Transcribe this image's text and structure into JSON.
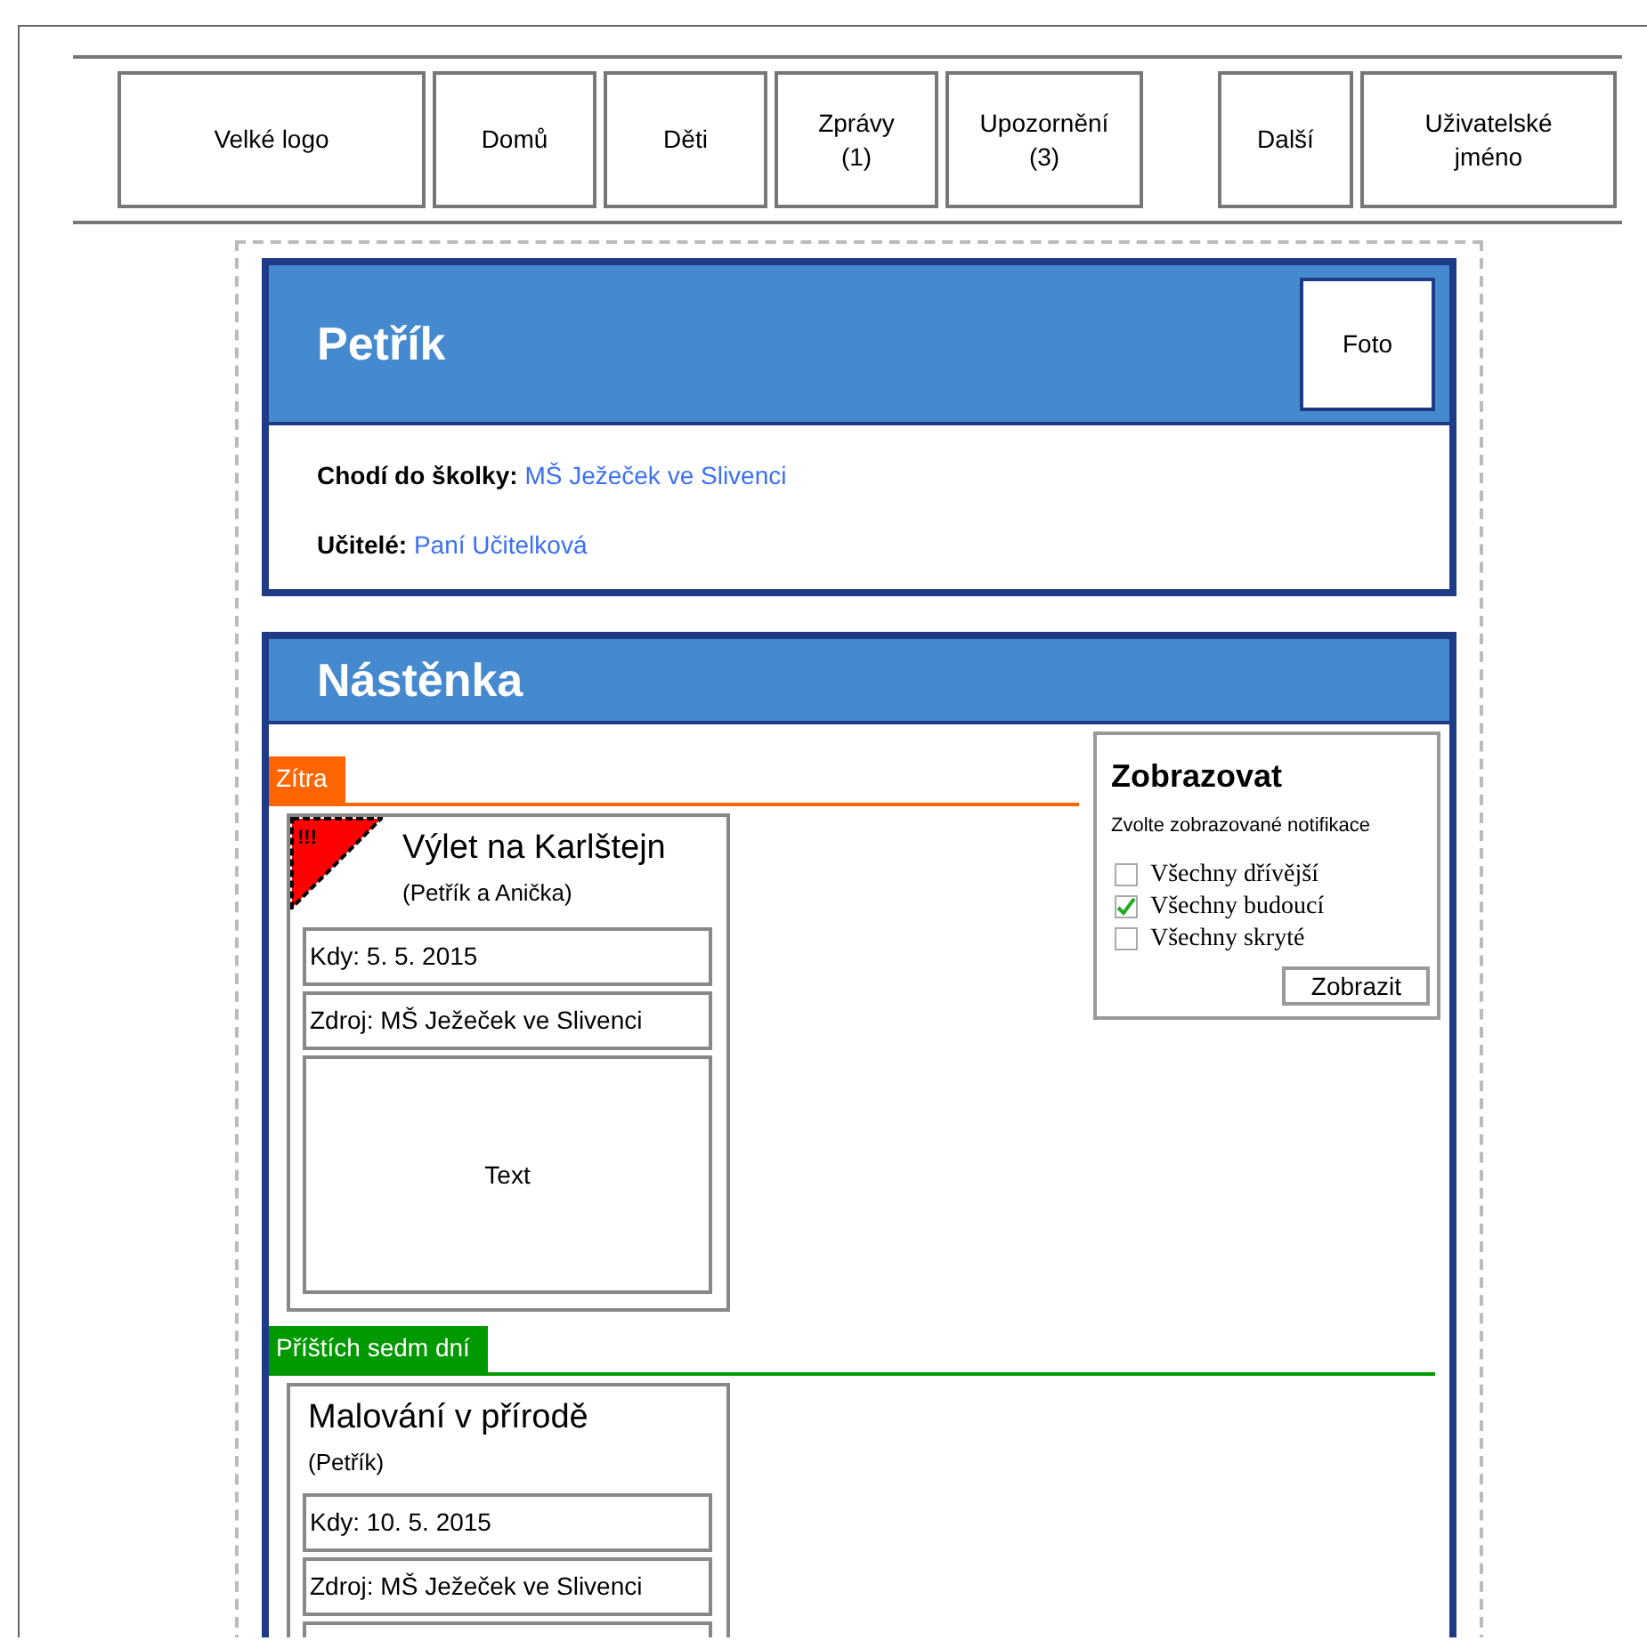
{
  "nav": {
    "logo": "Velké logo",
    "left": [
      {
        "label": "Domů"
      },
      {
        "label": "Děti"
      },
      {
        "label": "Zprávy (1)"
      },
      {
        "label": "Upozornění (3)"
      }
    ],
    "right": [
      {
        "label": "Další"
      },
      {
        "label": "Uživatelské jméno"
      }
    ]
  },
  "profile": {
    "name": "Petřík",
    "photo": "Foto",
    "facts": [
      {
        "label": "Chodí do školky:",
        "value": "MŠ Ježeček ve Slivenci"
      },
      {
        "label": "Učitelé:",
        "value": "Paní Učitelková"
      }
    ]
  },
  "board": {
    "title": "Nástěnka",
    "sections": [
      {
        "label": "Zítra",
        "color": "#ff6600",
        "events": [
          {
            "title": "Výlet na Karlštejn",
            "participants": "(Petřík a Anička)",
            "urgent": "!!!",
            "fields": [
              "Kdy: 5. 5. 2015",
              "Zdroj: MŠ Ježeček ve Slivenci"
            ],
            "body": "Text"
          }
        ]
      },
      {
        "label": "Příštích sedm dní",
        "color": "#009900",
        "events": [
          {
            "title": "Malování v přírodě",
            "participants": "(Petřík)",
            "fields": [
              "Kdy: 10. 5. 2015",
              "Zdroj: MŠ Ježeček ve Slivenci"
            ]
          }
        ]
      }
    ],
    "filter": {
      "title": "Zobrazovat",
      "hint": "Zvolte zobrazované notifikace",
      "options": [
        {
          "label": "Všechny dřívější",
          "checked": false
        },
        {
          "label": "Všechny budoucí",
          "checked": true
        },
        {
          "label": "Všechny skryté",
          "checked": false
        }
      ],
      "button": "Zobrazit"
    }
  }
}
